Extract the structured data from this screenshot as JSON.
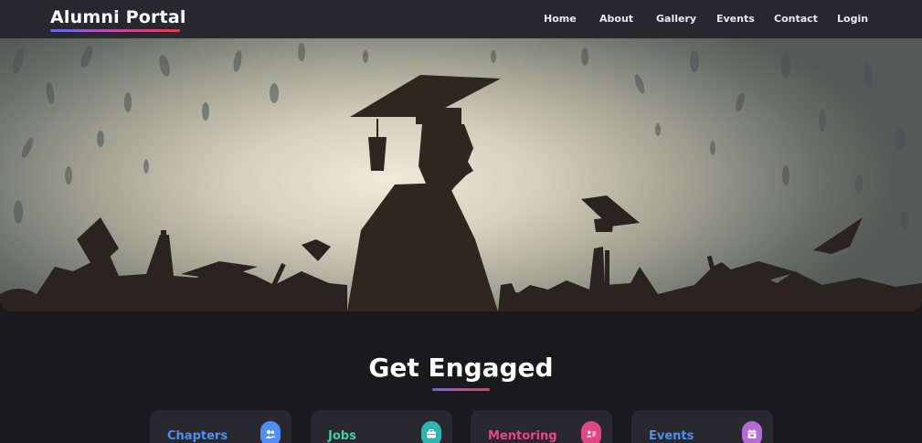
{
  "brand": {
    "title": "Alumni Portal"
  },
  "nav": {
    "items": [
      {
        "label": "Home"
      },
      {
        "label": "About"
      },
      {
        "label": "Gallery"
      },
      {
        "label": "Events"
      },
      {
        "label": "Contact"
      },
      {
        "label": "Login"
      }
    ]
  },
  "hero": {
    "image": "graduation-silhouette-banner"
  },
  "section": {
    "title": "Get Engaged",
    "cards": [
      {
        "label": "Chapters",
        "color": "#4e8ff0",
        "icon": "users-icon"
      },
      {
        "label": "Jobs",
        "color": "#3fd1a0",
        "icon": "briefcase-icon"
      },
      {
        "label": "Mentoring",
        "color": "#e8458e",
        "icon": "id-card-icon"
      },
      {
        "label": "Events",
        "color": "#4e8ff0",
        "icon": "calendar-icon"
      }
    ],
    "icon_colors": [
      "#4f8ff5",
      "#2bb6b2",
      "#e0467f",
      "#b56ad6"
    ]
  }
}
